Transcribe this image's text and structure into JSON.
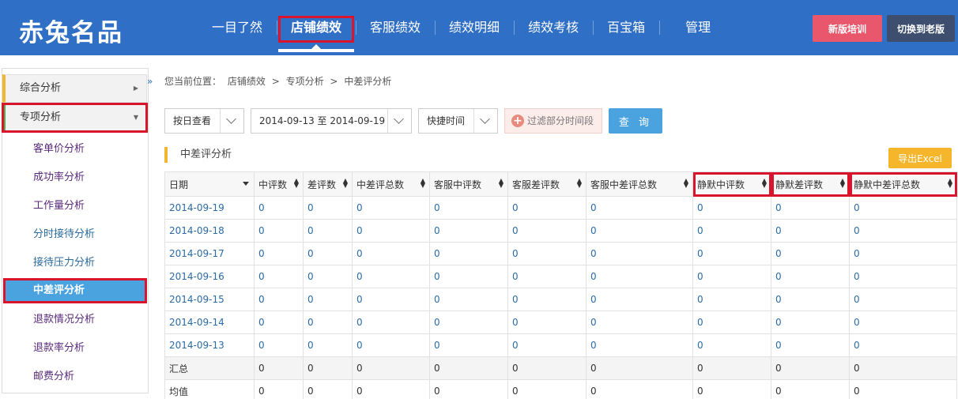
{
  "header": {
    "logo": "赤兔名品",
    "nav": [
      "一目了然",
      "店铺绩效",
      "客服绩效",
      "绩效明细",
      "绩效考核",
      "百宝箱",
      "管理"
    ],
    "active_nav": 1,
    "btn_training": "新版培训",
    "btn_old": "切换到老版"
  },
  "sidebar": {
    "groups": [
      {
        "label": "综合分析"
      },
      {
        "label": "专项分析"
      }
    ],
    "items": [
      "客单价分析",
      "成功率分析",
      "工作量分析",
      "分时接待分析",
      "接待压力分析",
      "中差评分析",
      "退款情况分析",
      "退款率分析",
      "邮费分析"
    ],
    "selected_item": 5
  },
  "breadcrumb": {
    "prefix": "您当前位置：",
    "path": [
      "店铺绩效",
      "专项分析",
      "中差评分析"
    ],
    "sep": ">"
  },
  "toolbar": {
    "view_mode": "按日查看",
    "date_range": "2014-09-13 至 2014-09-19",
    "quick_time": "快捷时间",
    "filter_label": "过滤部分时间段",
    "query": "查 询"
  },
  "section": {
    "title": "中差评分析",
    "export": "导出Excel"
  },
  "table": {
    "headers": [
      "日期",
      "中评数",
      "差评数",
      "中差评总数",
      "客服中评数",
      "客服差评数",
      "客服中差评总数",
      "静默中评数",
      "静默差评数",
      "静默中差评总数"
    ],
    "rows": [
      [
        "2014-09-19",
        "0",
        "0",
        "0",
        "0",
        "0",
        "0",
        "0",
        "0",
        "0"
      ],
      [
        "2014-09-18",
        "0",
        "0",
        "0",
        "0",
        "0",
        "0",
        "0",
        "0",
        "0"
      ],
      [
        "2014-09-17",
        "0",
        "0",
        "0",
        "0",
        "0",
        "0",
        "0",
        "0",
        "0"
      ],
      [
        "2014-09-16",
        "0",
        "0",
        "0",
        "0",
        "0",
        "0",
        "0",
        "0",
        "0"
      ],
      [
        "2014-09-15",
        "0",
        "0",
        "0",
        "0",
        "0",
        "0",
        "0",
        "0",
        "0"
      ],
      [
        "2014-09-14",
        "0",
        "0",
        "0",
        "0",
        "0",
        "0",
        "0",
        "0",
        "0"
      ],
      [
        "2014-09-13",
        "0",
        "0",
        "0",
        "0",
        "0",
        "0",
        "0",
        "0",
        "0"
      ]
    ],
    "summary": [
      "汇总",
      "0",
      "0",
      "0",
      "0",
      "0",
      "0",
      "0",
      "0",
      "0"
    ],
    "average": [
      "均值",
      "0",
      "0",
      "0",
      "0",
      "0",
      "0",
      "0",
      "0",
      "0"
    ]
  },
  "colors": {
    "header_bg": "#2f6fc6",
    "highlight_red": "#d9152d",
    "selected_blue": "#4aa3df",
    "accent_yellow": "#f0b830"
  }
}
